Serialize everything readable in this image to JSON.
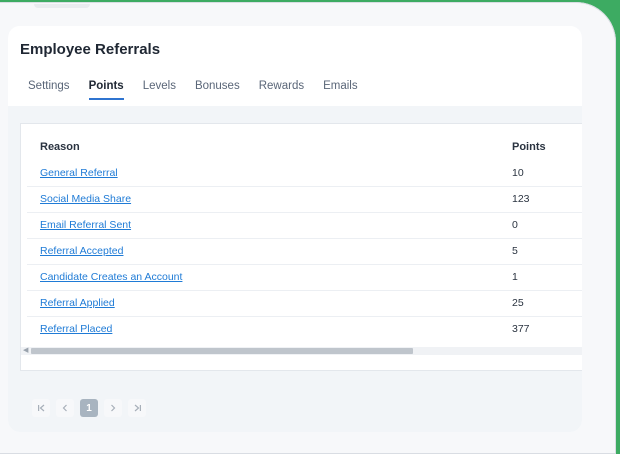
{
  "header": {
    "title": "Employee Referrals"
  },
  "tabs": [
    {
      "label": "Settings"
    },
    {
      "label": "Points"
    },
    {
      "label": "Levels"
    },
    {
      "label": "Bonuses"
    },
    {
      "label": "Rewards"
    },
    {
      "label": "Emails"
    }
  ],
  "active_tab": "Points",
  "table": {
    "columns": [
      "Reason",
      "Points"
    ],
    "rows": [
      {
        "reason": "General Referral",
        "points": "10"
      },
      {
        "reason": "Social Media Share",
        "points": "123"
      },
      {
        "reason": "Email Referral Sent",
        "points": "0"
      },
      {
        "reason": "Referral Accepted",
        "points": "5"
      },
      {
        "reason": "Candidate Creates an Account",
        "points": "1"
      },
      {
        "reason": "Referral Applied",
        "points": "25"
      },
      {
        "reason": "Referral Placed",
        "points": "377"
      }
    ]
  },
  "pagination": {
    "first_icon": "first-page-icon",
    "prev_icon": "previous-page-icon",
    "current_page": "1",
    "next_icon": "next-page-icon",
    "last_icon": "last-page-icon"
  },
  "colors": {
    "accent": "#2f74d0",
    "link": "#1f7bd6",
    "background": "#3dab62"
  }
}
